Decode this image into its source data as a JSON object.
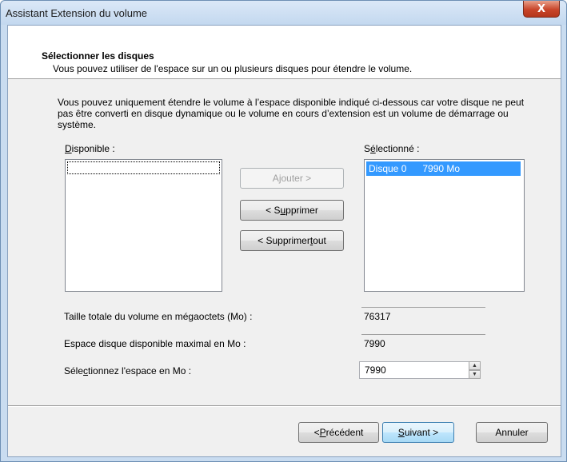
{
  "window": {
    "title": "Assistant Extension du volume",
    "close_glyph": "X"
  },
  "header": {
    "title": "Sélectionner les disques",
    "subtitle": "Vous pouvez utiliser de l'espace sur un ou plusieurs disques pour étendre le volume."
  },
  "info": {
    "text": "Vous pouvez uniquement étendre le volume à l’espace disponible indiqué ci-dessous car votre disque ne peut pas être converti en disque dynamique ou le volume en cours d’extension est un volume de démarrage ou système."
  },
  "available": {
    "label_accel": "D",
    "label_rest": "isponible :",
    "items": []
  },
  "selected": {
    "label_pre": "S",
    "label_accel": "é",
    "label_rest": "lectionné :",
    "items": [
      {
        "disk": "Disque 0",
        "size": "7990 Mo"
      }
    ]
  },
  "buttons": {
    "add_pre": "A",
    "add_accel": "j",
    "add_rest": "outer >",
    "remove_pre": "< S",
    "remove_accel": "u",
    "remove_rest": "pprimer",
    "remove_all_pre": "< Supprimer ",
    "remove_all_accel": "t",
    "remove_all_rest": "out",
    "back_pre": "< ",
    "back_accel": "P",
    "back_rest": "récédent",
    "next_accel": "S",
    "next_rest": "uivant >",
    "cancel": "Annuler"
  },
  "fields": {
    "total_label": "Taille totale du volume en mégaoctets (Mo) :",
    "total_value": "76317",
    "max_label": "Espace disque disponible maximal en Mo :",
    "max_value": "7990",
    "select_pre": "Séle",
    "select_accel": "c",
    "select_rest": "tionnez l'espace en Mo :",
    "select_value": "7990"
  }
}
